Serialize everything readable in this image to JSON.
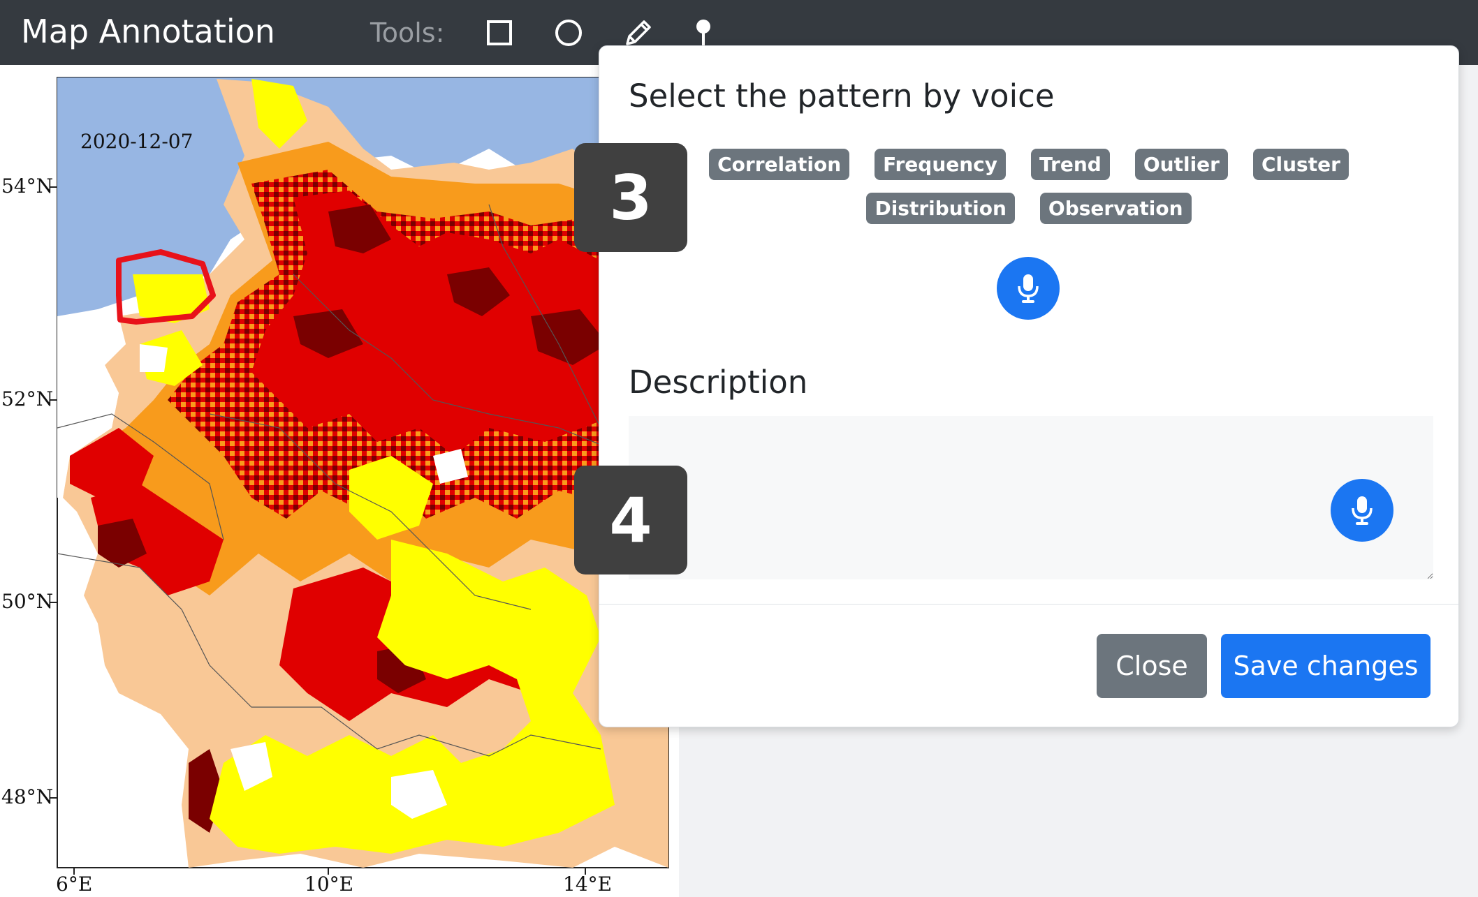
{
  "app": {
    "title": "Map Annotation",
    "tools_label": "Tools:"
  },
  "tools": [
    {
      "name": "rectangle-tool",
      "icon": "square-icon"
    },
    {
      "name": "circle-tool",
      "icon": "circle-icon"
    },
    {
      "name": "pen-tool",
      "icon": "pencil-icon"
    },
    {
      "name": "marker-tool",
      "icon": "map-pin-icon"
    }
  ],
  "map": {
    "date": "2020-12-07",
    "lat_labels": [
      "54°N",
      "52°N",
      "50°N",
      "48°N"
    ],
    "lon_labels": [
      "6°E",
      "10°E",
      "14°E"
    ],
    "colors": {
      "sea": "#97b6e3",
      "darkred": "#7a0000",
      "red": "#e00000",
      "orange": "#f89b1c",
      "lightorange": "#f9c896",
      "yellow": "#ffff00",
      "annotation": "#e8121a"
    }
  },
  "modal": {
    "title": "Select the pattern by voice",
    "patterns": [
      "Correlation",
      "Frequency",
      "Trend",
      "Outlier",
      "Cluster",
      "Distribution",
      "Observation"
    ],
    "description_heading": "Description",
    "description_value": "",
    "close_label": "Close",
    "save_label": "Save changes"
  },
  "steps": [
    "3",
    "4"
  ],
  "colors": {
    "navbar": "#353a40",
    "primary": "#1b76f2",
    "secondary": "#6c757d"
  }
}
